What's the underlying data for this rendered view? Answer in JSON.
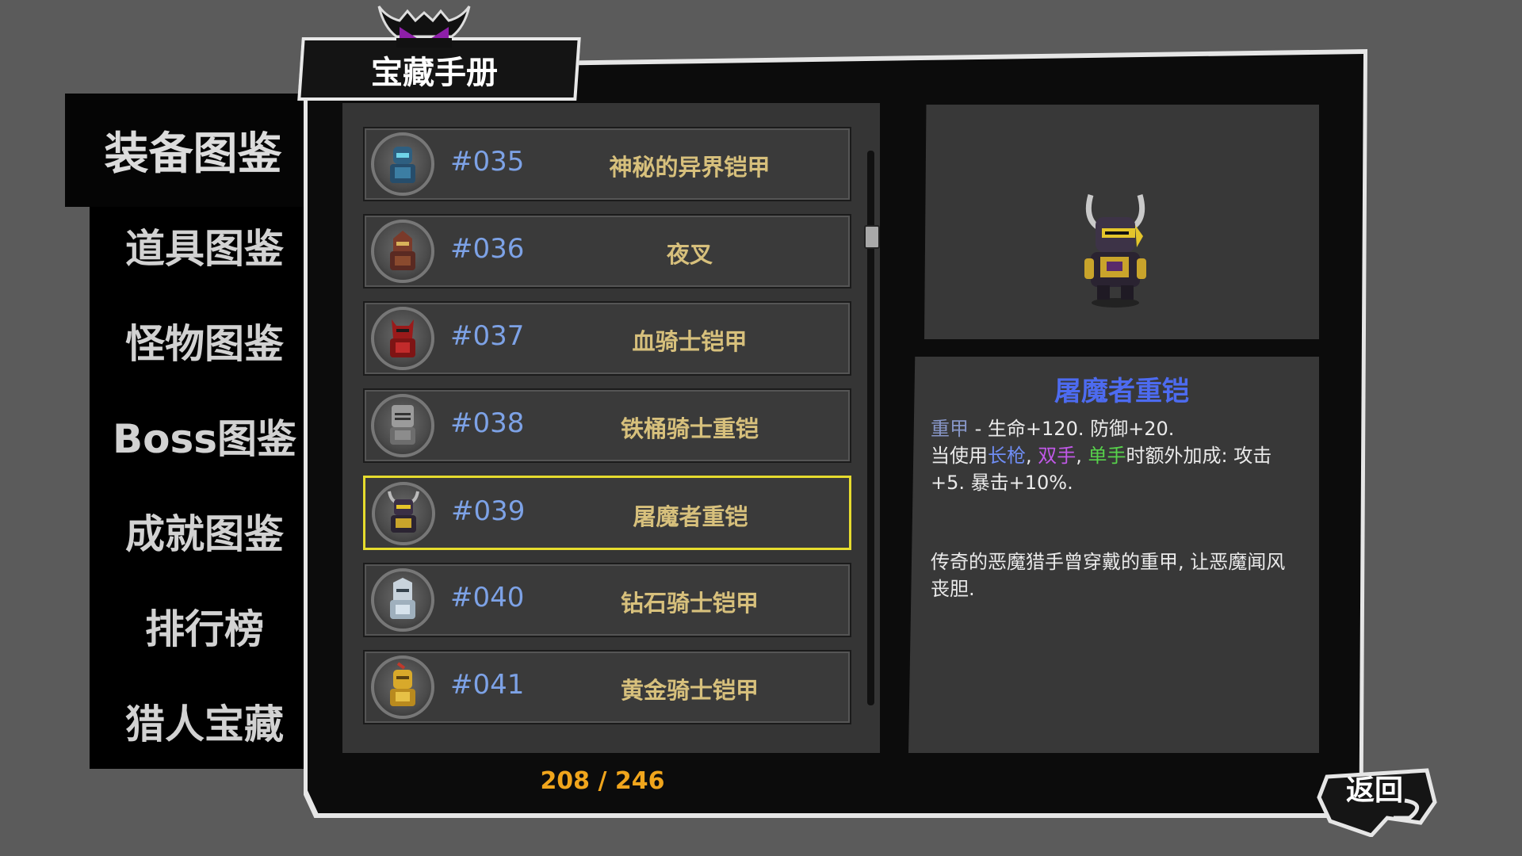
{
  "title": "宝藏手册",
  "sidebar": {
    "items": [
      {
        "label": "装备图鉴",
        "active": true
      },
      {
        "label": "道具图鉴",
        "active": false
      },
      {
        "label": "怪物图鉴",
        "active": false
      },
      {
        "label": "Boss图鉴",
        "active": false
      },
      {
        "label": "成就图鉴",
        "active": false
      },
      {
        "label": "排行榜",
        "active": false
      },
      {
        "label": "猎人宝藏",
        "active": false
      }
    ]
  },
  "list": {
    "rows": [
      {
        "num": "#035",
        "name": "神秘的异界铠甲",
        "icon": "mystic-armor-icon"
      },
      {
        "num": "#036",
        "name": "夜叉",
        "icon": "yaksha-armor-icon"
      },
      {
        "num": "#037",
        "name": "血骑士铠甲",
        "icon": "blood-knight-armor-icon"
      },
      {
        "num": "#038",
        "name": "铁桶骑士重铠",
        "icon": "bucket-knight-armor-icon"
      },
      {
        "num": "#039",
        "name": "屠魔者重铠",
        "icon": "demon-slayer-armor-icon",
        "selected": true
      },
      {
        "num": "#040",
        "name": "钻石骑士铠甲",
        "icon": "diamond-knight-armor-icon"
      },
      {
        "num": "#041",
        "name": "黄金骑士铠甲",
        "icon": "golden-knight-armor-icon"
      }
    ],
    "counter": {
      "current": "208",
      "separator": " / ",
      "total": "246"
    }
  },
  "detail": {
    "title": "屠魔者重铠",
    "type": "重甲",
    "stats_line": " - 生命+120. 防御+20.",
    "bonus_prefix": "当使用",
    "weapon_spear": "长枪",
    "comma1": ", ",
    "weapon_twohand": "双手",
    "comma2": ", ",
    "weapon_onehand": "单手",
    "bonus_suffix": "时额外加成: 攻击+5. 暴击+10%.",
    "lore": "传奇的恶魔猎手曾穿戴的重甲, 让恶魔闻风丧胆."
  },
  "back_button": {
    "label": "返回"
  },
  "colors": {
    "accent_selected": "#e6dc2e",
    "number_blue": "#7da2e6",
    "name_gold": "#d7c07c",
    "title_blue": "#4d6bf0",
    "counter_orange": "#f0a51c"
  }
}
